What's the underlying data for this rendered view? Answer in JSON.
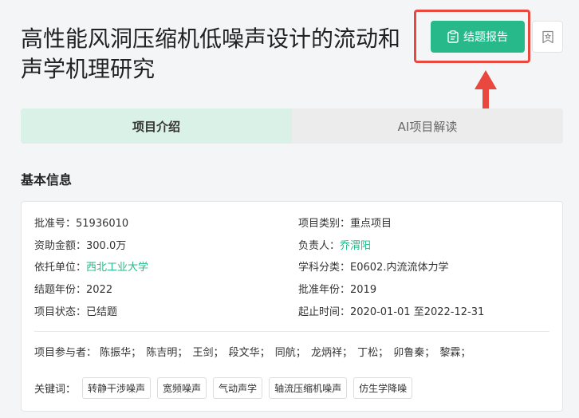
{
  "header": {
    "title_line1": "高性能风洞压缩机低噪声设计的流动和",
    "title_line2": "声学机理研究",
    "report_button": "结题报告"
  },
  "tabs": [
    {
      "label": "项目介绍",
      "active": true
    },
    {
      "label": "AI项目解读",
      "active": false
    }
  ],
  "section_title": "基本信息",
  "info": {
    "approval_no": {
      "k": "批准号：",
      "v": "51936010"
    },
    "category": {
      "k": "项目类别：",
      "v": "重点项目"
    },
    "funding": {
      "k": "资助金额：",
      "v": "300.0万"
    },
    "leader": {
      "k": "负责人：",
      "v": "乔渭阳"
    },
    "institution": {
      "k": "依托单位：",
      "v": "西北工业大学"
    },
    "discipline": {
      "k": "学科分类：",
      "v": "E0602.内流流体力学"
    },
    "end_year": {
      "k": "结题年份：",
      "v": "2022"
    },
    "approval_year": {
      "k": "批准年份：",
      "v": "2019"
    },
    "status": {
      "k": "项目状态：",
      "v": "已结题"
    },
    "period": {
      "k": "起止时间：",
      "v": "2020-01-01 至2022-12-31"
    }
  },
  "members": {
    "label": "项目参与者：",
    "names": [
      "陈振华；",
      "陈吉明；",
      "王剑；",
      "段文华；",
      "同航；",
      "龙炳祥；",
      "丁松；",
      "卯鲁秦；",
      "黎霖；"
    ]
  },
  "keywords": {
    "label": "关键词：",
    "items": [
      "转静干涉噪声",
      "宽频噪声",
      "气动声学",
      "轴流压缩机噪声",
      "仿生学降噪"
    ]
  },
  "colors": {
    "accent": "#27b98a",
    "highlight": "#e8483d",
    "tab_active_bg": "#d9f1e7"
  }
}
